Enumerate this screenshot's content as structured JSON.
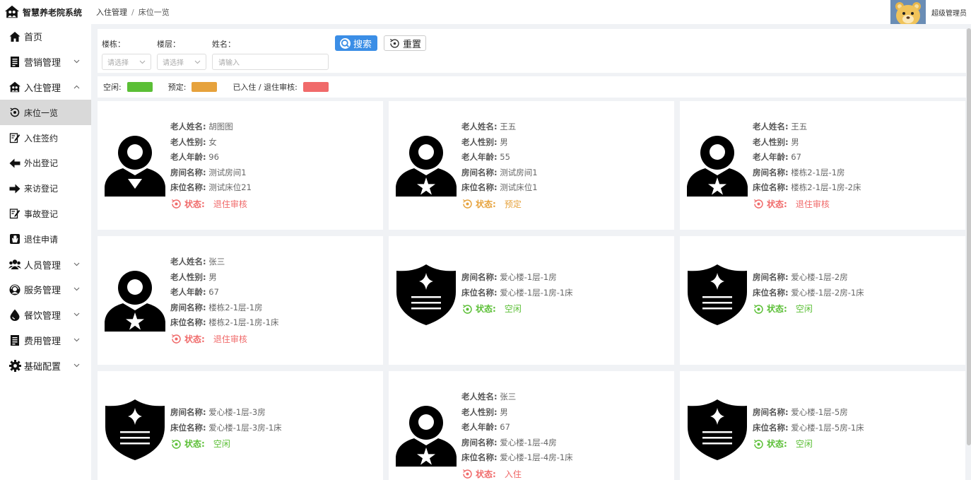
{
  "header": {
    "app_title": "智慧养老院系统",
    "breadcrumb": [
      "入住管理",
      "床位一览"
    ],
    "user_name": "超级管理员"
  },
  "sidebar": {
    "items": [
      {
        "label": "首页",
        "icon": "home-icon",
        "expandable": false,
        "sub": false
      },
      {
        "label": "营销管理",
        "icon": "document-icon",
        "expandable": true,
        "chevron": "⌄",
        "sub": false
      },
      {
        "label": "入住管理",
        "icon": "house-people-icon",
        "expandable": true,
        "chevron": "⌃",
        "sub": false
      },
      {
        "label": "床位一览",
        "icon": "eye-icon",
        "expandable": false,
        "sub": true,
        "active": true
      },
      {
        "label": "入住签约",
        "icon": "sign-icon",
        "expandable": false,
        "sub": true
      },
      {
        "label": "外出登记",
        "icon": "arrow-left-icon",
        "expandable": false,
        "sub": true
      },
      {
        "label": "来访登记",
        "icon": "arrow-right-icon",
        "expandable": false,
        "sub": true
      },
      {
        "label": "事故登记",
        "icon": "sign-icon",
        "expandable": false,
        "sub": true
      },
      {
        "label": "退住申请",
        "icon": "hand-icon",
        "expandable": false,
        "sub": true
      },
      {
        "label": "人员管理",
        "icon": "people-icon",
        "expandable": true,
        "chevron": "⌄",
        "sub": false
      },
      {
        "label": "服务管理",
        "icon": "headset-icon",
        "expandable": true,
        "chevron": "⌄",
        "sub": false
      },
      {
        "label": "餐饮管理",
        "icon": "drop-icon",
        "expandable": true,
        "chevron": "⌄",
        "sub": false
      },
      {
        "label": "费用管理",
        "icon": "document-icon",
        "expandable": true,
        "chevron": "⌄",
        "sub": false
      },
      {
        "label": "基础配置",
        "icon": "gear-icon",
        "expandable": true,
        "chevron": "⌄",
        "sub": false
      }
    ]
  },
  "filters": {
    "building_label": "楼栋：",
    "building_placeholder": "请选择",
    "floor_label": "楼层：",
    "floor_placeholder": "请选择",
    "name_label": "姓名：",
    "name_placeholder": "请输入",
    "search_label": "搜索",
    "reset_label": "重置"
  },
  "legend": [
    {
      "label": "空闲:",
      "color": "#5bbf36"
    },
    {
      "label": "预定:",
      "color": "#e6a23c"
    },
    {
      "label": "已入住 / 退住审核:",
      "color": "#f06a6a"
    }
  ],
  "labels": {
    "name": "老人姓名:",
    "gender": "老人性别:",
    "age": "老人年龄:",
    "room": "房间名称:",
    "bed": "床位名称:",
    "status": "状态:"
  },
  "status_colors": {
    "退住审核": "#f06a6a",
    "入住": "#f06a6a",
    "预定": "#e6a23c",
    "空闲": "#5bbf36"
  },
  "beds": [
    {
      "name": "胡图图",
      "gender": "女",
      "age": "96",
      "room": "测试房间1",
      "bed": "测试床位21",
      "status": "退住审核",
      "icon": "person-female-icon"
    },
    {
      "name": "王五",
      "gender": "男",
      "age": "55",
      "room": "测试房间1",
      "bed": "测试床位1",
      "status": "预定",
      "icon": "person-male-icon"
    },
    {
      "name": "王五",
      "gender": "男",
      "age": "67",
      "room": "楼栋2-1层-1房",
      "bed": "楼栋2-1层-1房-2床",
      "status": "退住审核",
      "icon": "person-male-icon"
    },
    {
      "name": "张三",
      "gender": "男",
      "age": "67",
      "room": "楼栋2-1层-1房",
      "bed": "楼栋2-1层-1房-1床",
      "status": "退住审核",
      "icon": "person-male-icon"
    },
    {
      "room": "爱心楼-1层-1房",
      "bed": "爱心楼-1层-1房-1床",
      "status": "空闲",
      "icon": "shield-icon"
    },
    {
      "room": "爱心楼-1层-2房",
      "bed": "爱心楼-1层-2房-1床",
      "status": "空闲",
      "icon": "shield-icon"
    },
    {
      "room": "爱心楼-1层-3房",
      "bed": "爱心楼-1层-3房-1床",
      "status": "空闲",
      "icon": "shield-icon"
    },
    {
      "name": "张三",
      "gender": "男",
      "age": "67",
      "room": "爱心楼-1层-4房",
      "bed": "爱心楼-1层-4房-1床",
      "status": "入住",
      "icon": "person-male-icon"
    },
    {
      "room": "爱心楼-1层-5房",
      "bed": "爱心楼-1层-5房-1床",
      "status": "空闲",
      "icon": "shield-icon"
    }
  ]
}
